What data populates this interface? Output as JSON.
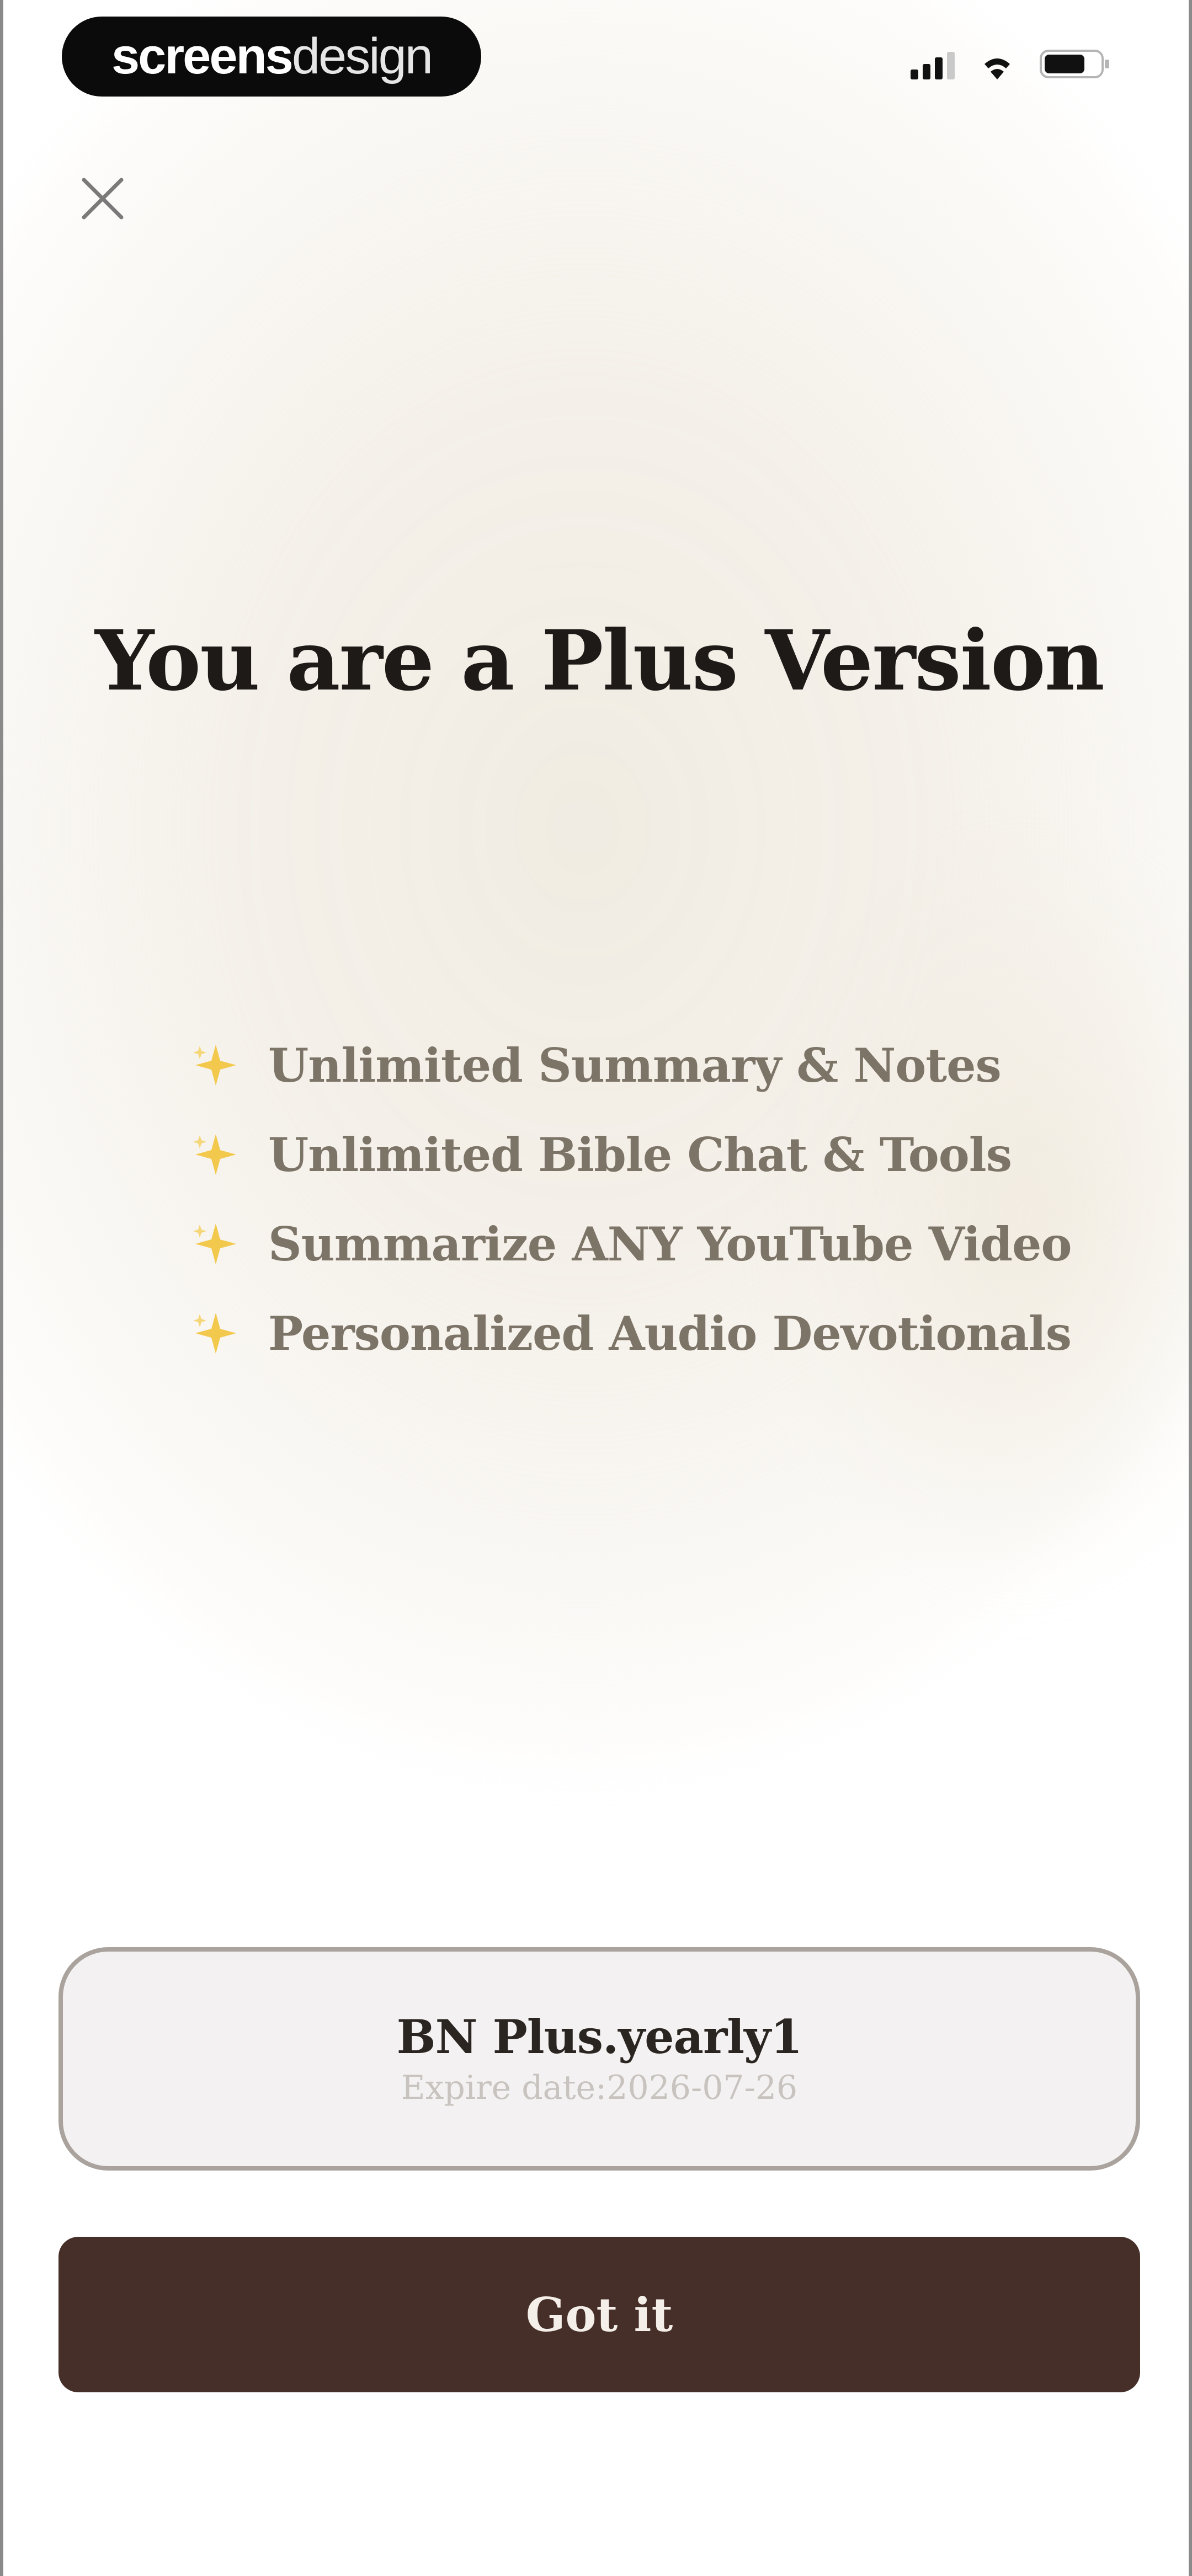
{
  "status_bar": {
    "brand": {
      "part1": "screens",
      "part2": "design"
    },
    "icons": [
      "cellular-signal-icon",
      "wifi-icon",
      "battery-icon"
    ]
  },
  "header": {
    "close_icon": "close-icon"
  },
  "main": {
    "title": "You are a Plus Version",
    "features": [
      {
        "icon": "sparkle-icon",
        "label": "Unlimited Summary & Notes"
      },
      {
        "icon": "sparkle-icon",
        "label": "Unlimited Bible Chat & Tools"
      },
      {
        "icon": "sparkle-icon",
        "label": "Summarize ANY YouTube Video"
      },
      {
        "icon": "sparkle-icon",
        "label": "Personalized Audio Devotionals"
      }
    ]
  },
  "plan": {
    "name": "BN Plus.yearly1",
    "expire": "Expire date:2026-07-26"
  },
  "actions": {
    "got_it_label": "Got it"
  },
  "colors": {
    "background_glow": "#f1ece2",
    "title": "#1d1a17",
    "feature_text": "#7d7468",
    "sparkle": "#f2c94c",
    "button_bg": "#472f29",
    "button_text": "#f5efe9",
    "card_border": "#a9a29d",
    "card_bg": "#f3f1f1"
  }
}
